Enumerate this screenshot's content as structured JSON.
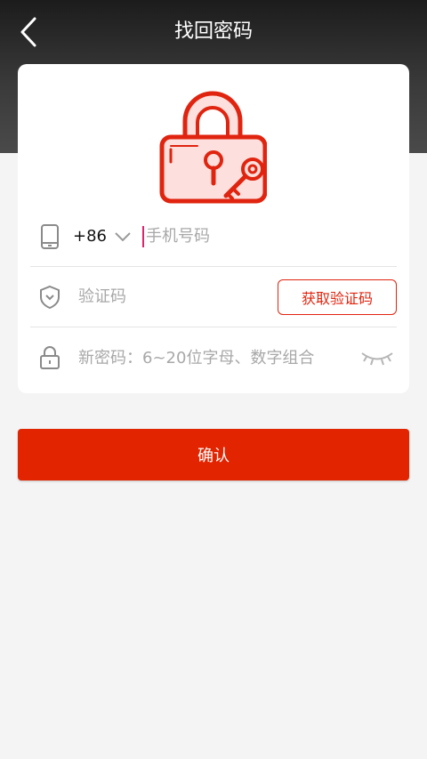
{
  "header": {
    "title": "找回密码",
    "back_icon": "chevron-left-icon"
  },
  "form": {
    "phone": {
      "icon": "phone-icon",
      "country_code": "+86",
      "placeholder": "手机号码",
      "value": ""
    },
    "verification": {
      "icon": "shield-icon",
      "placeholder": "验证码",
      "value": "",
      "get_code_label": "获取验证码"
    },
    "password": {
      "icon": "lock-icon",
      "placeholder": "新密码：6~20位字母、数字组合",
      "value": "",
      "visibility_icon": "eye-closed-icon"
    }
  },
  "confirm_label": "确认",
  "colors": {
    "accent": "#e22400",
    "cursor": "#e0246c",
    "header_dark": "#2a2a2a"
  }
}
